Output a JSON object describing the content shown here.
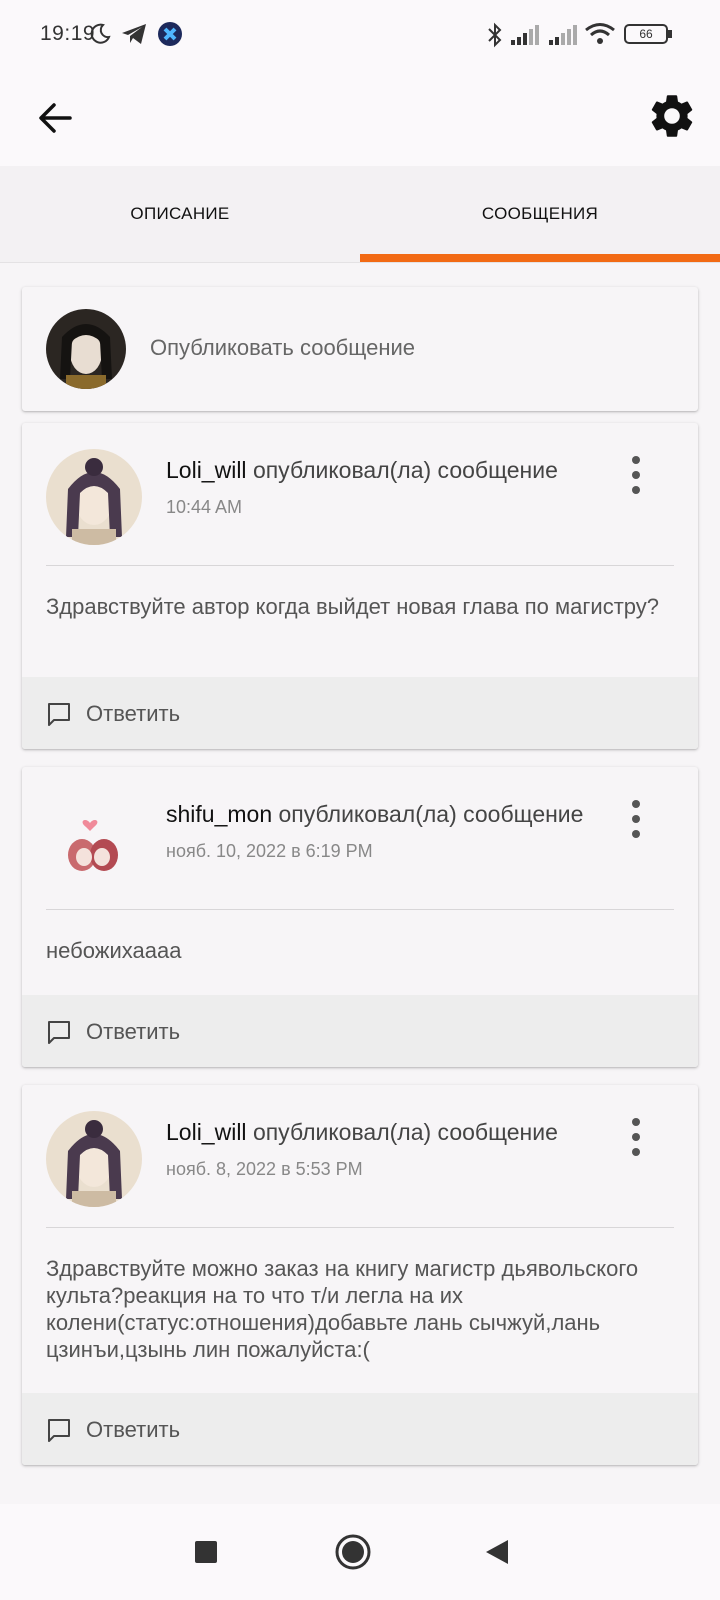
{
  "status_bar": {
    "time": "19:19",
    "icons": [
      "moon-icon",
      "telegram-icon",
      "app-badge-icon",
      "bluetooth-icon",
      "signal-icon",
      "signal-icon",
      "wifi-icon",
      "battery-icon"
    ],
    "battery_level": "66"
  },
  "app_bar": {
    "back_icon": "arrow-left-icon",
    "settings_icon": "gear-icon"
  },
  "tabs": [
    {
      "label": "ОПИСАНИЕ",
      "active": false
    },
    {
      "label": "СООБЩЕНИЯ",
      "active": true
    }
  ],
  "accent_color": "#f26a14",
  "compose": {
    "placeholder": "Опубликовать сообщение"
  },
  "posts": [
    {
      "author": "Loli_will",
      "action": "опубликовал(ла) сообщение",
      "time": "10:44 AM",
      "body": "Здравствуйте автор когда выйдет новая глава по магистру?",
      "reply_label": "Ответить"
    },
    {
      "author": "shifu_mon",
      "action": "опубликовал(ла) сообщение",
      "time": "нояб. 10, 2022 в 6:19 PM",
      "body": "небожихаааа",
      "reply_label": "Ответить"
    },
    {
      "author": "Loli_will",
      "action": "опубликовал(ла) сообщение",
      "time": "нояб. 8, 2022 в 5:53 PM",
      "body": "Здравствуйте можно заказ на книгу магистр дьявольского культа?реакция на то что т/и легла на их колени(статус:отношения)добавьте лань сычжуй,лань цзинъи,цзынь лин пожалуйста:(",
      "reply_label": "Ответить"
    }
  ],
  "nav_bar": {
    "icons": [
      "recents-square-icon",
      "home-circle-icon",
      "back-triangle-icon"
    ]
  }
}
